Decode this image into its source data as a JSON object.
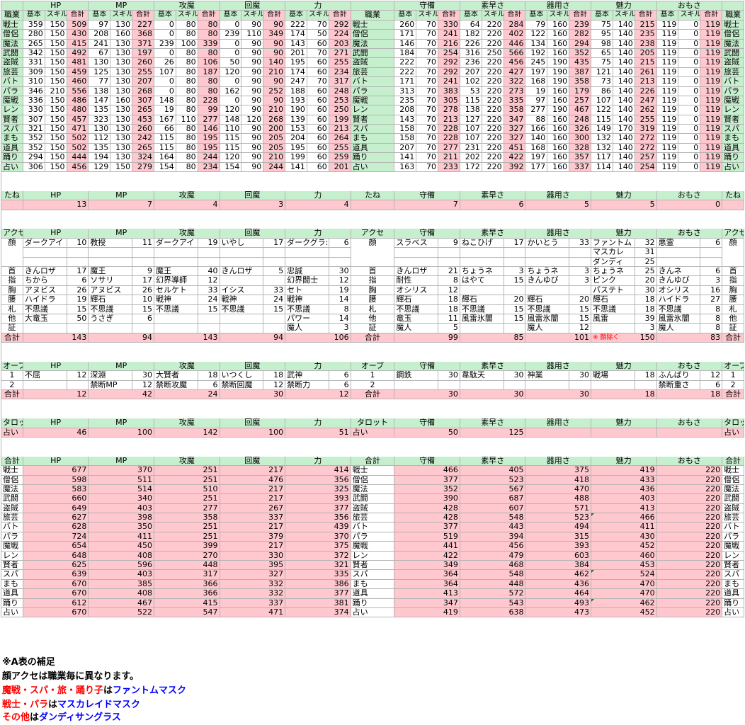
{
  "colors": {
    "green": "#c6efce",
    "pink": "#ffc7ce",
    "red": "#ff0000",
    "blue": "#0000ff"
  },
  "jobs": [
    "戦士",
    "僧侶",
    "魔法",
    "武闘",
    "盗賊",
    "旅芸",
    "バト",
    "パラ",
    "魔戦",
    "レン",
    "賢者",
    "スパ",
    "まも",
    "道具",
    "踊り",
    "占い"
  ],
  "headers": {
    "row1": {
      "job": "職業",
      "HP": "HP",
      "MP": "MP",
      "atk": "攻魔",
      "heal": "回魔",
      "str": "力",
      "def": "守備",
      "spd": "素早さ",
      "dex": "器用さ",
      "charm": "魅力",
      "fun": "おもさ"
    },
    "row2": {
      "job": "職業",
      "base": "基本",
      "skill": "スキル",
      "total": "合計"
    }
  },
  "statsLeft": [
    [
      359,
      150,
      509,
      97,
      130,
      227,
      0,
      80,
      80,
      0,
      90,
      90,
      222,
      70,
      292
    ],
    [
      280,
      150,
      430,
      208,
      160,
      368,
      0,
      80,
      80,
      239,
      110,
      349,
      174,
      50,
      224
    ],
    [
      265,
      150,
      415,
      241,
      130,
      371,
      239,
      100,
      339,
      0,
      90,
      90,
      143,
      60,
      203
    ],
    [
      342,
      150,
      492,
      67,
      130,
      197,
      0,
      80,
      80,
      0,
      90,
      90,
      201,
      70,
      271
    ],
    [
      331,
      150,
      481,
      130,
      130,
      260,
      26,
      80,
      106,
      50,
      90,
      140,
      195,
      60,
      255
    ],
    [
      309,
      150,
      459,
      125,
      130,
      255,
      107,
      80,
      187,
      120,
      90,
      210,
      174,
      60,
      234
    ],
    [
      310,
      150,
      460,
      77,
      130,
      207,
      0,
      80,
      80,
      0,
      90,
      90,
      247,
      70,
      317
    ],
    [
      346,
      210,
      556,
      138,
      130,
      268,
      0,
      80,
      80,
      162,
      90,
      252,
      188,
      60,
      248
    ],
    [
      336,
      150,
      486,
      147,
      160,
      307,
      148,
      80,
      228,
      0,
      90,
      90,
      193,
      60,
      253
    ],
    [
      330,
      150,
      480,
      135,
      130,
      265,
      19,
      80,
      99,
      120,
      90,
      210,
      190,
      60,
      250
    ],
    [
      307,
      150,
      457,
      323,
      130,
      453,
      167,
      110,
      277,
      148,
      120,
      268,
      139,
      60,
      199
    ],
    [
      321,
      150,
      471,
      130,
      130,
      260,
      66,
      80,
      146,
      110,
      90,
      200,
      153,
      60,
      213
    ],
    [
      352,
      150,
      502,
      112,
      130,
      242,
      115,
      80,
      195,
      115,
      90,
      205,
      204,
      60,
      264
    ],
    [
      352,
      150,
      502,
      135,
      130,
      265,
      115,
      80,
      195,
      115,
      90,
      205,
      195,
      60,
      255
    ],
    [
      294,
      150,
      444,
      194,
      130,
      324,
      164,
      80,
      244,
      120,
      90,
      210,
      199,
      60,
      259
    ],
    [
      306,
      150,
      456,
      129,
      150,
      279,
      154,
      80,
      234,
      154,
      90,
      244,
      141,
      60,
      201
    ]
  ],
  "statsRight": [
    [
      260,
      70,
      330,
      64,
      220,
      284,
      79,
      160,
      239,
      75,
      140,
      215,
      119,
      0,
      119
    ],
    [
      171,
      70,
      241,
      182,
      220,
      402,
      122,
      160,
      282,
      95,
      140,
      235,
      119,
      0,
      119
    ],
    [
      146,
      70,
      216,
      226,
      220,
      446,
      134,
      160,
      294,
      98,
      140,
      238,
      119,
      0,
      119
    ],
    [
      184,
      70,
      254,
      316,
      250,
      566,
      192,
      160,
      352,
      65,
      140,
      205,
      119,
      0,
      119
    ],
    [
      222,
      70,
      292,
      236,
      220,
      456,
      245,
      190,
      435,
      75,
      140,
      215,
      119,
      0,
      119
    ],
    [
      222,
      70,
      292,
      207,
      220,
      427,
      197,
      190,
      387,
      121,
      140,
      261,
      119,
      0,
      119
    ],
    [
      171,
      70,
      241,
      102,
      220,
      322,
      168,
      190,
      358,
      73,
      140,
      213,
      119,
      0,
      119
    ],
    [
      313,
      70,
      383,
      53,
      220,
      273,
      19,
      160,
      179,
      86,
      140,
      226,
      119,
      0,
      119
    ],
    [
      235,
      70,
      305,
      115,
      220,
      335,
      97,
      160,
      257,
      107,
      140,
      247,
      119,
      0,
      119
    ],
    [
      208,
      70,
      278,
      138,
      220,
      358,
      277,
      190,
      467,
      122,
      140,
      262,
      119,
      0,
      119
    ],
    [
      143,
      70,
      213,
      127,
      220,
      347,
      88,
      160,
      248,
      115,
      140,
      255,
      119,
      0,
      119
    ],
    [
      158,
      70,
      228,
      107,
      220,
      327,
      166,
      160,
      326,
      149,
      170,
      319,
      119,
      0,
      119
    ],
    [
      158,
      70,
      228,
      107,
      220,
      327,
      140,
      160,
      300,
      132,
      140,
      272,
      119,
      0,
      119
    ],
    [
      207,
      70,
      277,
      231,
      220,
      451,
      168,
      160,
      328,
      132,
      140,
      272,
      119,
      0,
      119
    ],
    [
      141,
      70,
      211,
      202,
      220,
      422,
      197,
      160,
      357,
      117,
      140,
      257,
      119,
      0,
      119
    ],
    [
      163,
      70,
      233,
      172,
      220,
      392,
      177,
      160,
      337,
      114,
      140,
      254,
      119,
      0,
      119
    ]
  ],
  "tane": {
    "label": "たね",
    "values": [
      13,
      7,
      4,
      3,
      4,
      7,
      6,
      5,
      5,
      0
    ]
  },
  "acce": {
    "label": "アクセ",
    "face": {
      "label": "顔",
      "lines": [
        [
          "ダークアイ",
          "10",
          "教授",
          "11",
          "ダークアイ",
          "19",
          "いやし",
          "17",
          "ダークグラ:",
          "6",
          "スラベス",
          "9",
          "ねこひげ",
          "17",
          "かいとう",
          "33",
          "ファントム",
          "32",
          "悪霊",
          "6"
        ],
        [
          "",
          "",
          "",
          "",
          "",
          "",
          "",
          "",
          "",
          "",
          "",
          "",
          "",
          "",
          "",
          "",
          "マスカレ",
          "31",
          "",
          ""
        ],
        [
          "",
          "",
          "",
          "",
          "",
          "",
          "",
          "",
          "",
          "",
          "",
          "",
          "",
          "",
          "",
          "",
          "ダンディ",
          "25",
          "",
          ""
        ]
      ]
    },
    "rows": [
      {
        "label": "首",
        "v": [
          "きんロザ",
          "17",
          "魔王",
          "9",
          "魔王",
          "40",
          "きんロザ",
          "5",
          "忠誠",
          "30",
          "きんロザ",
          "21",
          "ちょうネ",
          "3",
          "ちょうネ",
          "3",
          "ちょうネ",
          "25",
          "きんネ",
          "6"
        ]
      },
      {
        "label": "指",
        "v": [
          "ちから",
          "6",
          "ソサリ",
          "17",
          "幻界導師",
          "12",
          "",
          "",
          "幻界闘士",
          "12",
          "耐性",
          "8",
          "はやて",
          "15",
          "きんゆび",
          "3",
          "ピンク",
          "20",
          "きんゆび",
          "3"
        ]
      },
      {
        "label": "胸",
        "v": [
          "アヌビス",
          "26",
          "アヌビス",
          "26",
          "セルケト",
          "33",
          "イシス",
          "33",
          "セト",
          "19",
          "オシリス",
          "12",
          "",
          "",
          "",
          "",
          "パステト",
          "30",
          "オシリス",
          "16"
        ]
      },
      {
        "label": "腰",
        "v": [
          "ハイドラ",
          "19",
          "輝石",
          "10",
          "戦神",
          "24",
          "戦神",
          "24",
          "戦神",
          "14",
          "輝石",
          "18",
          "輝石",
          "20",
          "輝石",
          "20",
          "輝石",
          "18",
          "ハイドラ",
          "27"
        ]
      },
      {
        "label": "札",
        "v": [
          "不思議",
          "15",
          "不思議",
          "15",
          "不思議",
          "15",
          "不思議",
          "15",
          "不思議",
          "8",
          "不思議",
          "18",
          "不思議",
          "15",
          "不思議",
          "15",
          "不思議",
          "18",
          "不思議",
          "8"
        ]
      },
      {
        "label": "他",
        "v": [
          "大竜玉",
          "50",
          "うさぎ",
          "6",
          "",
          "",
          "",
          "",
          "パワー",
          "14",
          "竜玉",
          "11",
          "風雷氷闇",
          "15",
          "風雷氷闇",
          "15",
          "風雷",
          "39",
          "風雷氷闇",
          "8"
        ]
      },
      {
        "label": "証",
        "v": [
          "",
          "",
          "",
          "",
          "",
          "",
          "",
          "",
          "魔人",
          "3",
          "魔人",
          "5",
          "",
          "",
          "魔人",
          "12",
          "",
          "3",
          "魔人",
          "8"
        ]
      }
    ],
    "total": {
      "label": "合計",
      "values": [
        143,
        94,
        143,
        94,
        106,
        99,
        85,
        101,
        150,
        83
      ],
      "note": "※ 顔除く"
    }
  },
  "orb": {
    "label": "オーブ",
    "rows": [
      {
        "label": "1",
        "v": [
          "不屈",
          "12",
          "深淵",
          "30",
          "大賢者",
          "18",
          "いつくし",
          "18",
          "武神",
          "6",
          "鋼鉄",
          "30",
          "韋駄天",
          "30",
          "神業",
          "30",
          "戦場",
          "18",
          "ふんばり",
          "12"
        ]
      },
      {
        "label": "2",
        "v": [
          "",
          "",
          "禁断MP",
          "12",
          "禁断攻魔",
          "6",
          "禁断回魔",
          "12",
          "禁断力",
          "6",
          "",
          "",
          "",
          "",
          "",
          "",
          "",
          "",
          "禁断重さ",
          "6"
        ]
      }
    ],
    "total": {
      "label": "合計",
      "values": [
        12,
        42,
        24,
        30,
        12,
        30,
        30,
        30,
        18,
        18
      ]
    }
  },
  "tarot": {
    "label": "タロット",
    "row": "占い",
    "values": [
      46,
      100,
      142,
      100,
      51,
      50,
      125,
      "",
      "",
      ""
    ]
  },
  "sum": {
    "label": "合計",
    "values": [
      [
        677,
        370,
        251,
        217,
        414,
        466,
        405,
        375,
        419,
        220
      ],
      [
        598,
        511,
        251,
        476,
        356,
        377,
        523,
        418,
        433,
        220
      ],
      [
        583,
        514,
        510,
        217,
        325,
        352,
        567,
        470,
        436,
        220
      ],
      [
        660,
        340,
        251,
        217,
        393,
        390,
        687,
        488,
        403,
        220
      ],
      [
        649,
        403,
        277,
        267,
        377,
        428,
        607,
        571,
        413,
        220
      ],
      [
        627,
        398,
        358,
        337,
        356,
        428,
        548,
        523,
        466,
        220
      ],
      [
        628,
        350,
        251,
        217,
        439,
        377,
        443,
        494,
        411,
        220
      ],
      [
        724,
        411,
        251,
        379,
        370,
        519,
        394,
        315,
        430,
        220
      ],
      [
        654,
        450,
        399,
        217,
        375,
        441,
        456,
        393,
        452,
        220
      ],
      [
        648,
        408,
        270,
        330,
        372,
        422,
        479,
        603,
        460,
        220
      ],
      [
        625,
        596,
        448,
        395,
        321,
        349,
        468,
        384,
        453,
        220
      ],
      [
        639,
        403,
        317,
        327,
        335,
        364,
        548,
        462,
        524,
        220
      ],
      [
        670,
        385,
        366,
        332,
        386,
        364,
        448,
        436,
        470,
        220
      ],
      [
        670,
        408,
        366,
        332,
        377,
        413,
        572,
        464,
        470,
        220
      ],
      [
        612,
        467,
        415,
        337,
        381,
        347,
        543,
        493,
        462,
        220
      ],
      [
        670,
        522,
        547,
        471,
        374,
        419,
        638,
        473,
        452,
        220
      ]
    ]
  },
  "notes": {
    "title": "※A表の補足",
    "line1": "顔アクセは職業毎に異なります。",
    "line2a": "魔戦・スパ・旅・踊り子",
    "line2b": "は",
    "line2c": "ファントムマスク",
    "line3a": "戦士・パラ",
    "line3b": "は",
    "line3c": "マスカレイドマスク",
    "line4a": "その他",
    "line4b": "は",
    "line4c": "ダンディサングラス"
  }
}
